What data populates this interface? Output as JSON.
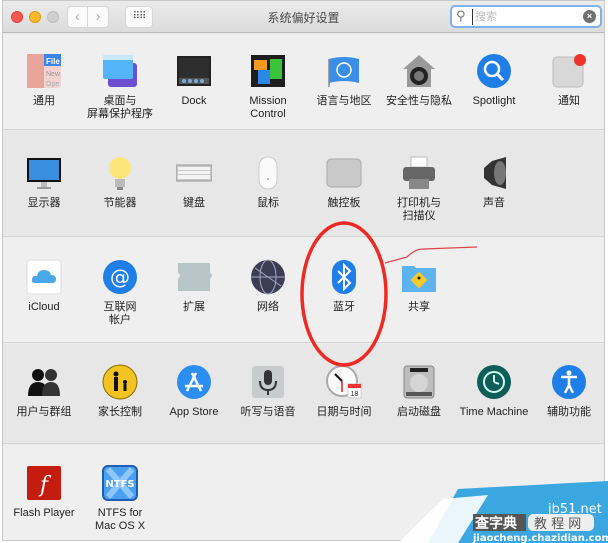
{
  "window": {
    "title": "系统偏好设置",
    "nav_back": "‹",
    "nav_forward": "›",
    "show_all": "⠿⠿",
    "search": {
      "value": "",
      "placeholder": "搜索",
      "icon": "search-icon",
      "clear_icon": "clear-icon",
      "clear_glyph": "×"
    }
  },
  "rows": [
    [
      {
        "id": "general",
        "label": "通用",
        "icon": "general-icon"
      },
      {
        "id": "desktop",
        "label": "桌面与\n屏幕保护程序",
        "icon": "desktop-screensaver-icon"
      },
      {
        "id": "dock",
        "label": "Dock",
        "icon": "dock-icon"
      },
      {
        "id": "mission-control",
        "label": "Mission\nControl",
        "icon": "mission-control-icon"
      },
      {
        "id": "language",
        "label": "语言与地区",
        "icon": "language-region-icon"
      },
      {
        "id": "security",
        "label": "安全性与隐私",
        "icon": "security-privacy-icon"
      },
      {
        "id": "spotlight",
        "label": "Spotlight",
        "icon": "spotlight-icon"
      },
      {
        "id": "notifications",
        "label": "通知",
        "icon": "notifications-icon"
      }
    ],
    [
      {
        "id": "displays",
        "label": "显示器",
        "icon": "display-icon"
      },
      {
        "id": "energy",
        "label": "节能器",
        "icon": "energy-saver-icon"
      },
      {
        "id": "keyboard",
        "label": "键盘",
        "icon": "keyboard-icon"
      },
      {
        "id": "mouse",
        "label": "鼠标",
        "icon": "mouse-icon"
      },
      {
        "id": "trackpad",
        "label": "触控板",
        "icon": "trackpad-icon"
      },
      {
        "id": "printers",
        "label": "打印机与\n扫描仪",
        "icon": "printer-icon"
      },
      {
        "id": "sound",
        "label": "声音",
        "icon": "sound-icon"
      }
    ],
    [
      {
        "id": "icloud",
        "label": "iCloud",
        "icon": "icloud-icon"
      },
      {
        "id": "internet-accounts",
        "label": "互联网\n帐户",
        "icon": "internet-accounts-icon"
      },
      {
        "id": "extensions",
        "label": "扩展",
        "icon": "extensions-icon"
      },
      {
        "id": "network",
        "label": "网络",
        "icon": "network-icon"
      },
      {
        "id": "bluetooth",
        "label": "蓝牙",
        "icon": "bluetooth-icon"
      },
      {
        "id": "sharing",
        "label": "共享",
        "icon": "sharing-icon"
      }
    ],
    [
      {
        "id": "users",
        "label": "用户与群组",
        "icon": "users-groups-icon"
      },
      {
        "id": "parental",
        "label": "家长控制",
        "icon": "parental-controls-icon"
      },
      {
        "id": "appstore",
        "label": "App Store",
        "icon": "app-store-icon"
      },
      {
        "id": "dictation",
        "label": "听写与语音",
        "icon": "dictation-speech-icon"
      },
      {
        "id": "datetime",
        "label": "日期与时间",
        "icon": "date-time-icon"
      },
      {
        "id": "startup",
        "label": "启动磁盘",
        "icon": "startup-disk-icon"
      },
      {
        "id": "timemachine",
        "label": "Time Machine",
        "icon": "time-machine-icon"
      },
      {
        "id": "accessibility",
        "label": "辅助功能",
        "icon": "accessibility-icon"
      }
    ],
    [
      {
        "id": "flash",
        "label": "Flash Player",
        "icon": "flash-player-icon"
      },
      {
        "id": "ntfs",
        "label": "NTFS for\nMac OS X",
        "icon": "ntfs-icon"
      }
    ]
  ],
  "icon_text": {
    "general_file": "File",
    "general_new": "New",
    "general_open": "Ope",
    "calendar_day": "18",
    "ntfs": "NTFS",
    "flash": "f"
  },
  "annotation": {
    "highlight": "bluetooth",
    "color": "#ee2a22"
  },
  "watermark": {
    "site": "jb51.net",
    "brand": "查字典",
    "tag": "教 程 网",
    "url": "jiaocheng.chazidian.com"
  }
}
